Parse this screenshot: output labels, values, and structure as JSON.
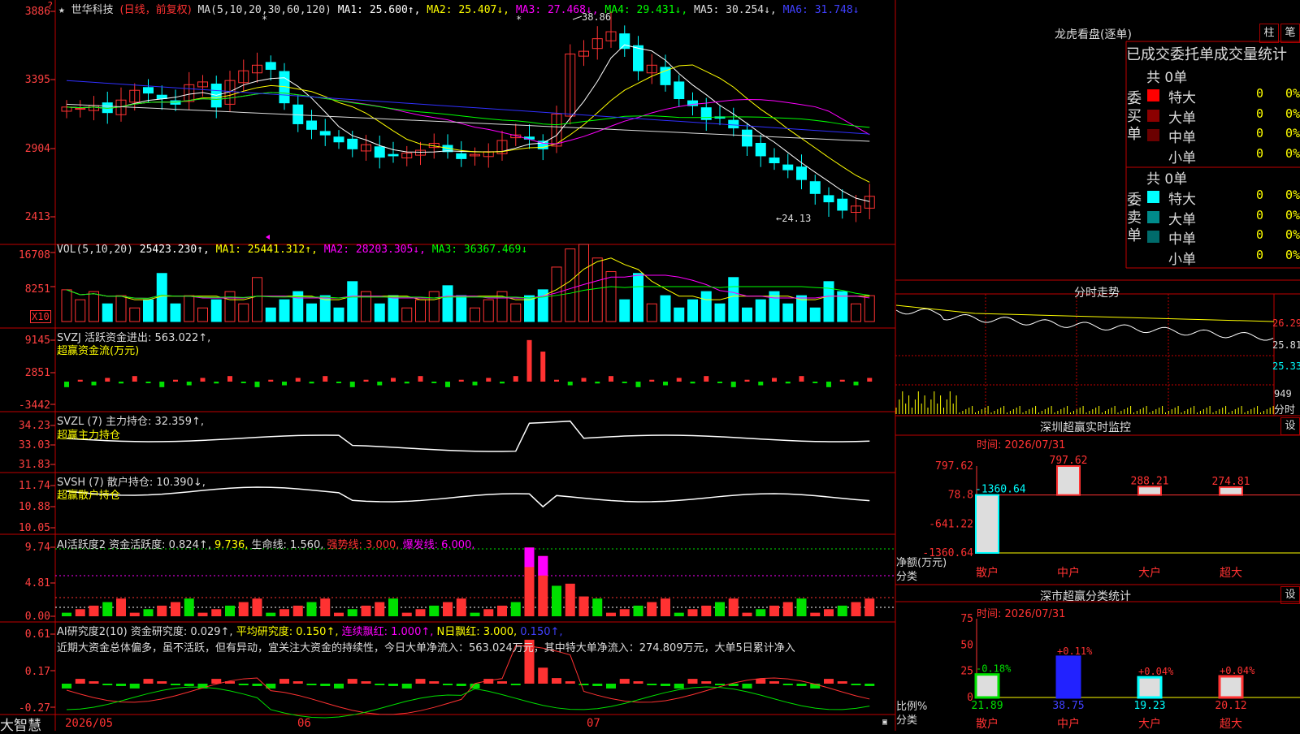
{
  "app": {
    "logo": "大智慧"
  },
  "colors": {
    "up": "#ff3232",
    "down": "#00ffff",
    "green": "#00e000",
    "bg": "#000000",
    "grid": "#a00000"
  },
  "kline": {
    "header": {
      "star": "★",
      "name": "世华科技",
      "mode": "(日线，前复权)",
      "ma_def": "MA(5,10,20,30,60,120)",
      "ma1": "MA1: 25.600↑,",
      "ma2": "MA2: 25.407↓,",
      "ma3": "MA3: 27.468↓,",
      "ma4": "MA4: 29.431↓,",
      "ma5": "MA5: 30.254↓,",
      "ma6": "MA6: 31.748↓"
    },
    "yticks": [
      "3886",
      "3395",
      "2904",
      "2413"
    ],
    "high_label": "38.86",
    "low_label": "←24.13"
  },
  "vol": {
    "header": "VOL(5,10,20)",
    "value": "25423.230↑,",
    "ma1": "MA1: 25441.312↑,",
    "ma2": "MA2: 28203.305↓,",
    "ma3": "MA3: 36367.469↓",
    "yticks": [
      "16708",
      "8251"
    ],
    "unit": "X10"
  },
  "svzj": {
    "header": "SVZJ  活跃资金进出: 563.022↑,",
    "sub": "超赢资金流(万元)",
    "yticks": [
      "9145",
      "2851",
      "-3442"
    ]
  },
  "svzl": {
    "header": "SVZL (7) 主力持仓: 32.359↑,",
    "sub": "超赢主力持仓",
    "yticks": [
      "34.23",
      "33.03",
      "31.83"
    ]
  },
  "svsh": {
    "header": "SVSH (7) 散户持仓: 10.390↓,",
    "sub": "超赢散户持仓",
    "yticks": [
      "11.74",
      "10.88",
      "10.05"
    ]
  },
  "ai_active": {
    "header": "AI活跃度2 资金活跃度: 0.824↑,",
    "v2": "9.736,",
    "life": "生命线: 1.560,",
    "strong": "强势线: 3.000,",
    "burst": "爆发线: 6.000,",
    "yticks": [
      "9.74",
      "4.81",
      "0.00"
    ]
  },
  "ai_research": {
    "header": "AI研究度2(10) 资金研究度: 0.029↑,",
    "avg": "平均研究度: 0.150↑,",
    "red": "连续飘红: 1.000↑,",
    "nred": "N日飘红: 3.000,",
    "last": "0.150↑,",
    "comment": "近期大资金总体偏多，虽不活跃，但有异动，宜关注大资金的持续性，今日大单净流入：563.024万元，其中特大单净流入：274.809万元，大单5日累计净入",
    "yticks": [
      "0.61",
      "0.17",
      "-0.27"
    ]
  },
  "xaxis": {
    "labels": [
      "2026/05",
      "06",
      "07"
    ]
  },
  "lhb": {
    "title": "龙虎看盘(逐单)",
    "btn1": "柱",
    "btn2": "笔",
    "subtitle": "已成交委托单成交量统计",
    "buy_label": "委买单",
    "sell_label": "委卖单",
    "buy_total": "共 0单",
    "sell_total": "共 0单",
    "buy_rows": [
      {
        "label": "特大",
        "count": "0",
        "pct": "0%",
        "color": "#ff0000"
      },
      {
        "label": "大单",
        "count": "0",
        "pct": "0%",
        "color": "#8b0000"
      },
      {
        "label": "中单",
        "count": "0",
        "pct": "0%",
        "color": "#6b0000"
      },
      {
        "label": "小单",
        "count": "0",
        "pct": "0%",
        "color": ""
      }
    ],
    "sell_rows": [
      {
        "label": "特大",
        "count": "0",
        "pct": "0%",
        "color": "#00ffff"
      },
      {
        "label": "大单",
        "count": "0",
        "pct": "0%",
        "color": "#008b8b"
      },
      {
        "label": "中单",
        "count": "0",
        "pct": "0%",
        "color": "#006b6b"
      },
      {
        "label": "小单",
        "count": "0",
        "pct": "0%",
        "color": ""
      }
    ]
  },
  "intraday": {
    "title": "分时走势",
    "yticks": [
      "26.29",
      "25.81",
      "25.33"
    ],
    "vol_tick": "949",
    "vol_label": "分时"
  },
  "monitor": {
    "title": "深圳超赢实时监控",
    "set": "设",
    "time": "时间: 2026/07/31",
    "yticks": [
      "797.62",
      "78.8",
      "-641.22",
      "-1360.64"
    ],
    "ylabel": "净额(万元)",
    "xlabel": "分类",
    "cats": [
      "散户",
      "中户",
      "大户",
      "超大"
    ],
    "values": [
      -1360.64,
      797.62,
      288.21,
      274.81
    ],
    "value_labels": [
      "-1360.64",
      "797.62",
      "288.21",
      "274.81"
    ]
  },
  "classify": {
    "title": "深市超赢分类统计",
    "set": "设",
    "time": "时间: 2026/07/31",
    "yticks": [
      "75",
      "50",
      "25",
      "0"
    ],
    "ylabel": "比例%",
    "xlabel": "分类",
    "cats": [
      "散户",
      "中户",
      "大户",
      "超大"
    ],
    "values": [
      21.89,
      38.75,
      19.23,
      20.12
    ],
    "value_labels": [
      "21.89",
      "38.75",
      "19.23",
      "20.12"
    ],
    "changes": [
      "-0.18%",
      "+0.11%",
      "+0.04%",
      "+0.04%"
    ]
  },
  "chart_data": [
    {
      "type": "bar",
      "title": "深圳超赢实时监控",
      "categories": [
        "散户",
        "中户",
        "大户",
        "超大"
      ],
      "values": [
        -1360.64,
        797.62,
        288.21,
        274.81
      ],
      "ylabel": "净额(万元)",
      "xlabel": "分类",
      "ylim": [
        -1360.64,
        797.62
      ]
    },
    {
      "type": "bar",
      "title": "深市超赢分类统计",
      "categories": [
        "散户",
        "中户",
        "大户",
        "超大"
      ],
      "values": [
        21.89,
        38.75,
        19.23,
        20.12
      ],
      "ylabel": "比例%",
      "xlabel": "分类",
      "ylim": [
        0,
        75
      ]
    }
  ]
}
